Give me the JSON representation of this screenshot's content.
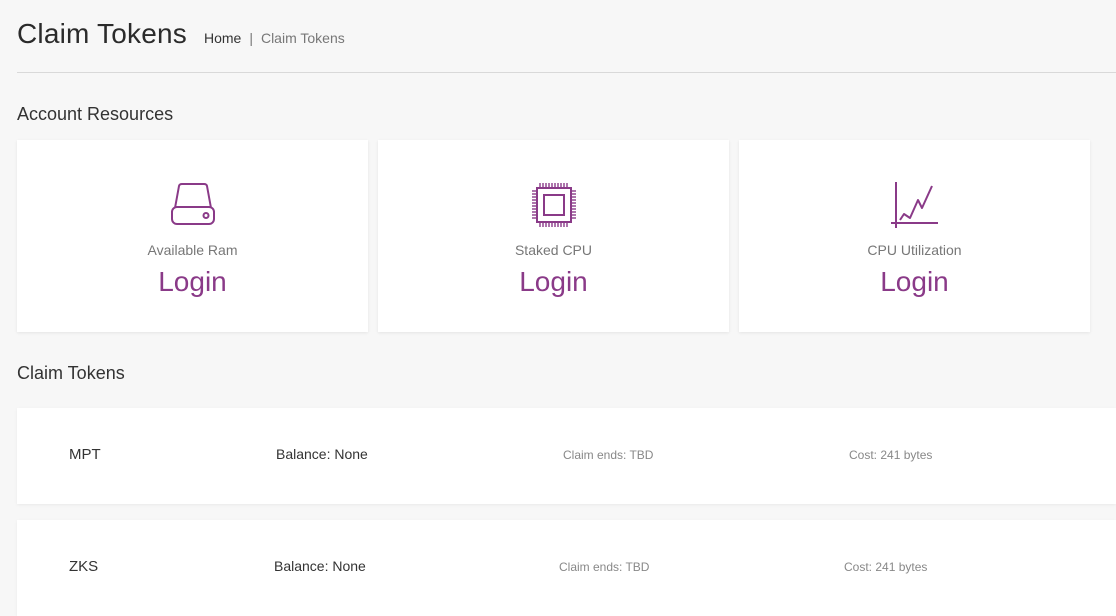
{
  "header": {
    "title": "Claim Tokens",
    "breadcrumb": {
      "home": "Home",
      "separator": "|",
      "current": "Claim Tokens"
    }
  },
  "resources": {
    "title": "Account Resources",
    "cards": [
      {
        "icon": "hard-drive-icon",
        "label": "Available Ram",
        "value": "Login"
      },
      {
        "icon": "cpu-chip-icon",
        "label": "Staked CPU",
        "value": "Login"
      },
      {
        "icon": "line-chart-icon",
        "label": "CPU Utilization",
        "value": "Login"
      }
    ]
  },
  "claim": {
    "title": "Claim Tokens",
    "tokens": [
      {
        "symbol": "MPT",
        "balance": "Balance: None",
        "claim_ends": "Claim ends: TBD",
        "cost": "Cost: 241 bytes"
      },
      {
        "symbol": "ZKS",
        "balance": "Balance: None",
        "claim_ends": "Claim ends: TBD",
        "cost": "Cost: 241 bytes"
      }
    ]
  },
  "colors": {
    "accent": "#8a3a88",
    "background": "#f7f7f7",
    "card": "#ffffff"
  }
}
